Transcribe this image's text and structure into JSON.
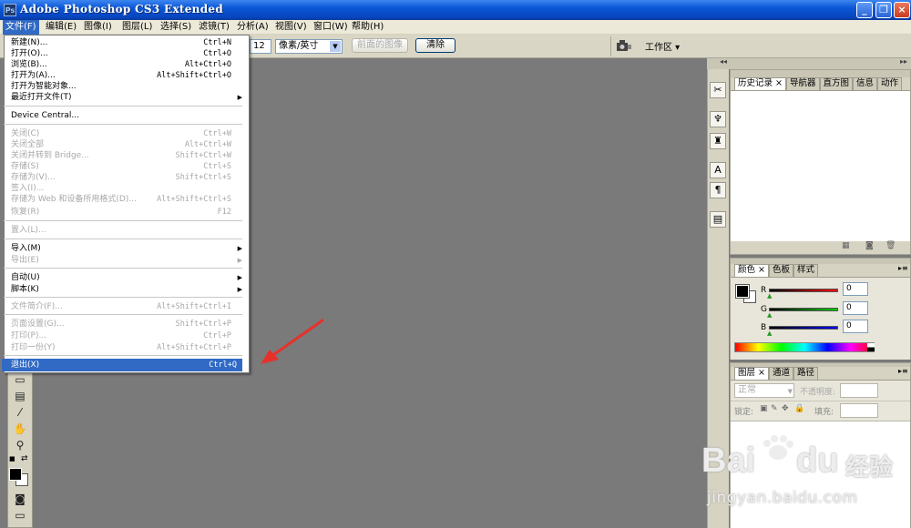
{
  "titlebar": {
    "logo": "Ps",
    "title": "Adobe Photoshop CS3 Extended",
    "min": "_",
    "restore": "❐",
    "close": "×"
  },
  "menubar": [
    {
      "id": "file",
      "label": "文件(F)"
    },
    {
      "id": "edit",
      "label": "编辑(E)"
    },
    {
      "id": "image",
      "label": "图像(I)"
    },
    {
      "id": "layer",
      "label": "图层(L)"
    },
    {
      "id": "select",
      "label": "选择(S)"
    },
    {
      "id": "filter",
      "label": "滤镜(T)"
    },
    {
      "id": "analysis",
      "label": "分析(A)"
    },
    {
      "id": "view",
      "label": "视图(V)"
    },
    {
      "id": "window",
      "label": "窗口(W)"
    },
    {
      "id": "help",
      "label": "帮助(H)"
    }
  ],
  "options": {
    "resolution_value": "12",
    "unit": "像素/英寸",
    "front_image_label": "前面的图像",
    "clear_label": "清除",
    "workspace_label": "工作区 ▾"
  },
  "file_menu": {
    "items": [
      {
        "label": "新建(N)...",
        "shortcut": "Ctrl+N"
      },
      {
        "label": "打开(O)...",
        "shortcut": "Ctrl+O"
      },
      {
        "label": "浏览(B)...",
        "shortcut": "Alt+Ctrl+O"
      },
      {
        "label": "打开为(A)...",
        "shortcut": "Alt+Shift+Ctrl+O"
      },
      {
        "label": "打开为智能对象...",
        "shortcut": ""
      },
      {
        "label": "最近打开文件(T)",
        "shortcut": ""
      },
      {
        "label": "Device Central...",
        "shortcut": ""
      },
      {
        "label": "关闭(C)",
        "shortcut": "Ctrl+W"
      },
      {
        "label": "关闭全部",
        "shortcut": "Alt+Ctrl+W"
      },
      {
        "label": "关闭并转到 Bridge...",
        "shortcut": "Shift+Ctrl+W"
      },
      {
        "label": "存储(S)",
        "shortcut": "Ctrl+S"
      },
      {
        "label": "存储为(V)...",
        "shortcut": "Shift+Ctrl+S"
      },
      {
        "label": "签入(I)...",
        "shortcut": ""
      },
      {
        "label": "存储为 Web 和设备所用格式(D)...",
        "shortcut": "Alt+Shift+Ctrl+S"
      },
      {
        "label": "恢复(R)",
        "shortcut": "F12"
      },
      {
        "label": "置入(L)...",
        "shortcut": ""
      },
      {
        "label": "导入(M)",
        "shortcut": ""
      },
      {
        "label": "导出(E)",
        "shortcut": ""
      },
      {
        "label": "自动(U)",
        "shortcut": ""
      },
      {
        "label": "脚本(K)",
        "shortcut": ""
      },
      {
        "label": "文件简介(F)...",
        "shortcut": "Alt+Shift+Ctrl+I"
      },
      {
        "label": "页面设置(G)...",
        "shortcut": "Shift+Ctrl+P"
      },
      {
        "label": "打印(P)...",
        "shortcut": "Ctrl+P"
      },
      {
        "label": "打印一份(Y)",
        "shortcut": "Alt+Shift+Ctrl+P"
      },
      {
        "label": "退出(X)",
        "shortcut": "Ctrl+Q"
      }
    ]
  },
  "panels": {
    "history_tabs": [
      "历史记录 ×",
      "导航器",
      "直方图",
      "信息",
      "动作"
    ],
    "color_tabs": [
      "颜色 ×",
      "色板",
      "样式"
    ],
    "color": {
      "r_label": "R",
      "g_label": "G",
      "b_label": "B",
      "r": "0",
      "g": "0",
      "b": "0"
    },
    "layers_tabs": [
      "图层 ×",
      "通道",
      "路径"
    ],
    "blend_mode": "正常",
    "opacity_label": "不透明度:",
    "lock_label": "锁定:",
    "fill_label": "填充:"
  },
  "watermark": {
    "brand": "Bai",
    "brand_b": "du",
    "brand_cn": "经验",
    "url": "jingyan.baidu.com"
  },
  "colors": {
    "titlebar": "#0a57d6",
    "selection": "#316ac5",
    "workspace": "#7a7a7a",
    "panel": "#d6d3c2",
    "arrow": "#e8302a"
  }
}
